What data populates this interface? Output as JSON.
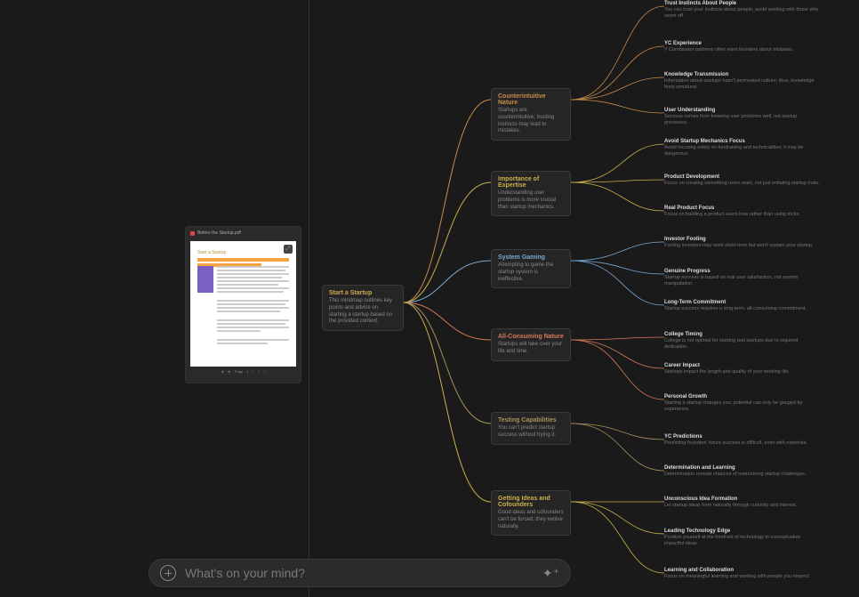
{
  "pdf": {
    "filename": "Before the Startup.pdf",
    "heading": "Start a Startup",
    "page_label": "Page",
    "page_value": "1"
  },
  "root": {
    "title": "Start a Startup",
    "desc": "This mindmap outlines key points and advice on starting a startup based on the provided context."
  },
  "branches": [
    {
      "title": "Counterintuitive Nature",
      "desc": "Startups are counterintuitive; trusting instincts may lead to mistakes.",
      "color": "#c98a4a",
      "leaves": [
        {
          "title": "Trust Instincts About People",
          "desc": "You can trust your instincts about people; avoid working with those who seem off."
        },
        {
          "title": "YC Experience",
          "desc": "Y Combinator partners often warn founders about mistakes."
        },
        {
          "title": "Knowledge Transmission",
          "desc": "Information about startups hasn't permeated culture; thus, knowledge feels unnatural."
        },
        {
          "title": "User Understanding",
          "desc": "Success comes from knowing user problems well, not startup processes."
        }
      ]
    },
    {
      "title": "Importance of Expertise",
      "desc": "Understanding user problems is more crucial than startup mechanics.",
      "color": "#c9b14a",
      "leaves": [
        {
          "title": "Avoid Startup Mechanics Focus",
          "desc": "Avoid focusing solely on fundraising and technicalities; it may be dangerous."
        },
        {
          "title": "Product Development",
          "desc": "Focus on creating something users want, not just imitating startup traits."
        },
        {
          "title": "Real Product Focus",
          "desc": "Focus on building a product users love rather than using tricks."
        }
      ]
    },
    {
      "title": "System Gaming",
      "desc": "Attempting to game the startup system is ineffective.",
      "color": "#7aa9d4",
      "leaves": [
        {
          "title": "Investor Fooling",
          "desc": "Fooling investors may work short-term but won't sustain your startup."
        },
        {
          "title": "Genuine Progress",
          "desc": "Startup success is based on real user satisfaction, not system manipulation."
        },
        {
          "title": "Long-Term Commitment",
          "desc": "Startup success requires a long-term, all-consuming commitment."
        }
      ]
    },
    {
      "title": "All-Consuming Nature",
      "desc": "Startups will take over your life and time.",
      "color": "#d47a5a",
      "leaves": [
        {
          "title": "College Timing",
          "desc": "College is not optimal for starting real startups due to required dedication."
        },
        {
          "title": "Career Impact",
          "desc": "Startups impact the length and quality of your working life."
        },
        {
          "title": "Personal Growth",
          "desc": "Starting a startup changes you; potential can only be gauged by experience."
        }
      ]
    },
    {
      "title": "Testing Capabilities",
      "desc": "You can't predict startup success without trying it.",
      "color": "#a8925a",
      "leaves": [
        {
          "title": "YC Predictions",
          "desc": "Predicting founders' future success is difficult, even with expertise."
        },
        {
          "title": "Determination and Learning",
          "desc": "Determination reveals chances of overcoming startup challenges."
        }
      ]
    },
    {
      "title": "Getting Ideas and Cofounders",
      "desc": "Good ideas and cofounders can't be forced; they evolve naturally.",
      "color": "#c9b14a",
      "leaves": [
        {
          "title": "Unconscious Idea Formation",
          "desc": "Let startup ideas form naturally through curiosity and interest."
        },
        {
          "title": "Leading Technology Edge",
          "desc": "Position yourself at the forefront of technology to conceptualize impactful ideas."
        },
        {
          "title": "Learning and Collaboration",
          "desc": "Focus on meaningful learning and working with people you respect."
        }
      ]
    }
  ],
  "prompt": {
    "placeholder": "What's on your mind?"
  }
}
